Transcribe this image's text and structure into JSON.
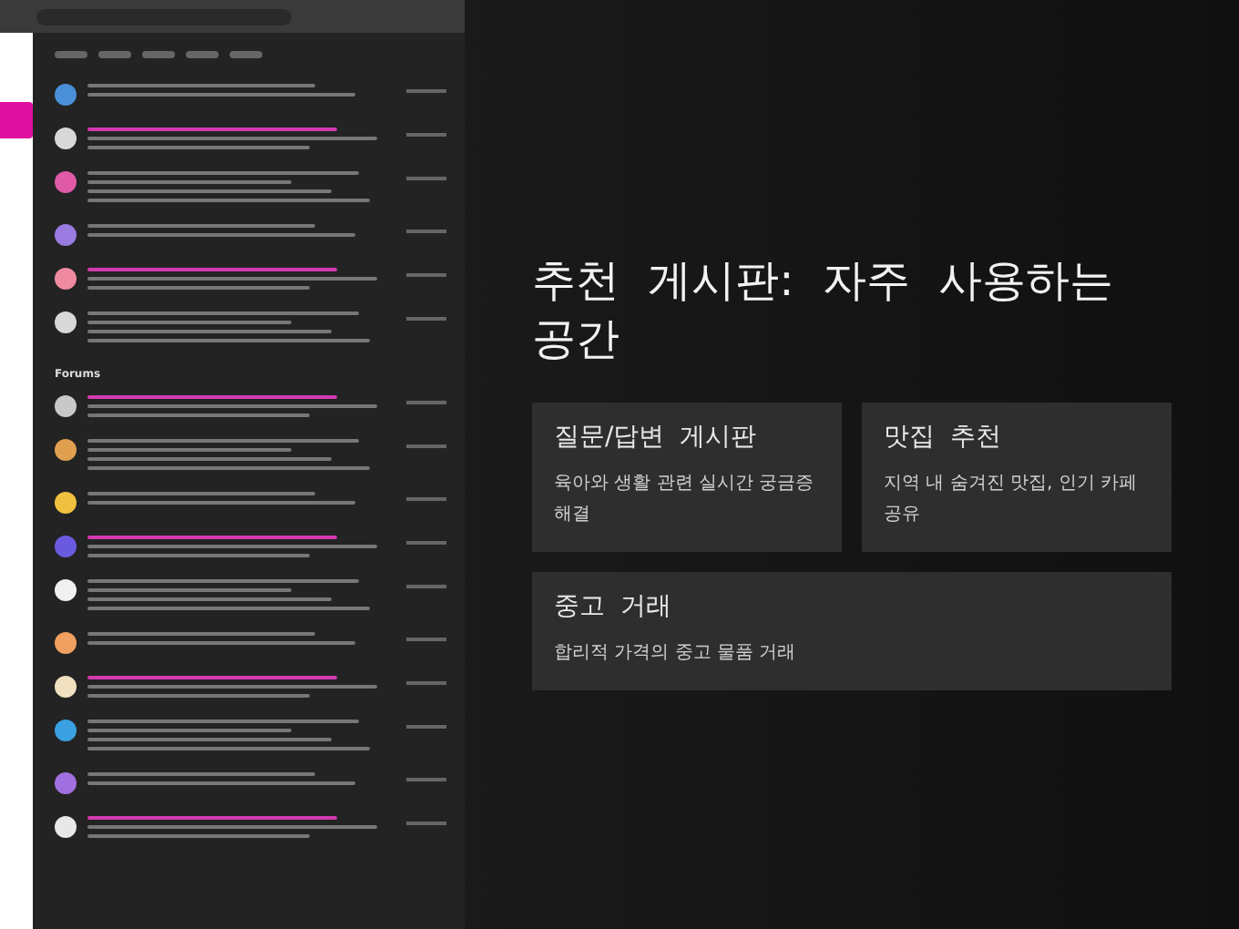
{
  "preview": {
    "section_title": "Forums"
  },
  "heading": "추천 게시판: 자주 사용하는 공간",
  "boards": [
    {
      "title": "질문/답변 게시판",
      "description": "육아와 생활 관련 실시간 궁금증 해결"
    },
    {
      "title": "맛집 추천",
      "description": "지역 내 숨겨진 맛집, 인기 카페 공유"
    },
    {
      "title": "중고 거래",
      "description": "합리적 가격의 중고 물품 거래"
    }
  ]
}
